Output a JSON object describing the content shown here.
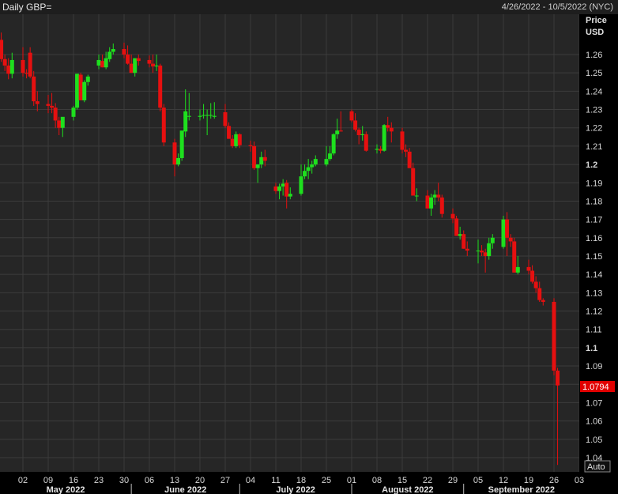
{
  "header": {
    "title": "Daily GBP=",
    "date_range": "4/26/2022 - 10/5/2022 (NYC)"
  },
  "axis": {
    "price_label": "Price",
    "currency_label": "USD",
    "auto_label": "Auto",
    "last_price_label": "1.0794"
  },
  "colors": {
    "background": "#262626",
    "grid": "#3c3c3c",
    "up": "#1ee01e",
    "down": "#e61010",
    "last_price_bg": "#e00000"
  },
  "chart_data": {
    "type": "candlestick",
    "title": "Daily GBP=",
    "ylabel": "Price USD",
    "ylim": [
      1.03,
      1.274
    ],
    "y_ticks": [
      1.04,
      1.05,
      1.06,
      1.07,
      1.08,
      1.09,
      1.1,
      1.11,
      1.12,
      1.13,
      1.14,
      1.15,
      1.16,
      1.17,
      1.18,
      1.19,
      1.2,
      1.21,
      1.22,
      1.23,
      1.24,
      1.25,
      1.26
    ],
    "y_tick_labels": [
      "1.04",
      "1.05",
      "1.06",
      "1.07",
      "",
      "1.09",
      "1.1",
      "1.11",
      "1.12",
      "1.13",
      "1.14",
      "1.15",
      "1.16",
      "1.17",
      "1.18",
      "1.19",
      "1.2",
      "1.21",
      "1.22",
      "1.23",
      "1.24",
      "1.25",
      "1.26"
    ],
    "bold_ticks": [
      "1.1",
      "1.2"
    ],
    "x_start": "2022-04-26",
    "x_end": "2022-10-05",
    "x_tick_dates": [
      "2022-05-02",
      "2022-05-09",
      "2022-05-16",
      "2022-05-23",
      "2022-05-30",
      "2022-06-06",
      "2022-06-13",
      "2022-06-20",
      "2022-06-27",
      "2022-07-04",
      "2022-07-11",
      "2022-07-18",
      "2022-07-25",
      "2022-08-01",
      "2022-08-08",
      "2022-08-15",
      "2022-08-22",
      "2022-08-29",
      "2022-09-05",
      "2022-09-12",
      "2022-09-19",
      "2022-09-26",
      "2022-10-03"
    ],
    "x_tick_labels": [
      "02",
      "09",
      "16",
      "23",
      "30",
      "06",
      "13",
      "20",
      "27",
      "04",
      "11",
      "18",
      "25",
      "01",
      "08",
      "15",
      "22",
      "29",
      "05",
      "12",
      "19",
      "26",
      "03"
    ],
    "months": [
      {
        "label": "May 2022",
        "date": "2022-05-02"
      },
      {
        "label": "June 2022",
        "date": "2022-06-01"
      },
      {
        "label": "July 2022",
        "date": "2022-07-01"
      },
      {
        "label": "August 2022",
        "date": "2022-08-01"
      },
      {
        "label": "September 2022",
        "date": "2022-09-01"
      }
    ],
    "last_price": 1.0794,
    "dates": [
      "2022-04-26",
      "2022-04-27",
      "2022-04-28",
      "2022-04-29",
      "2022-05-02",
      "2022-05-03",
      "2022-05-04",
      "2022-05-05",
      "2022-05-06",
      "2022-05-09",
      "2022-05-10",
      "2022-05-11",
      "2022-05-12",
      "2022-05-13",
      "2022-05-16",
      "2022-05-17",
      "2022-05-18",
      "2022-05-19",
      "2022-05-20",
      "2022-05-23",
      "2022-05-24",
      "2022-05-25",
      "2022-05-26",
      "2022-05-27",
      "2022-05-30",
      "2022-05-31",
      "2022-06-01",
      "2022-06-02",
      "2022-06-03",
      "2022-06-06",
      "2022-06-07",
      "2022-06-08",
      "2022-06-09",
      "2022-06-10",
      "2022-06-13",
      "2022-06-14",
      "2022-06-15",
      "2022-06-16",
      "2022-06-17",
      "2022-06-20",
      "2022-06-21",
      "2022-06-22",
      "2022-06-23",
      "2022-06-24",
      "2022-06-27",
      "2022-06-28",
      "2022-06-29",
      "2022-06-30",
      "2022-07-01",
      "2022-07-04",
      "2022-07-05",
      "2022-07-06",
      "2022-07-07",
      "2022-07-08",
      "2022-07-11",
      "2022-07-12",
      "2022-07-13",
      "2022-07-14",
      "2022-07-15",
      "2022-07-18",
      "2022-07-19",
      "2022-07-20",
      "2022-07-21",
      "2022-07-22",
      "2022-07-25",
      "2022-07-26",
      "2022-07-27",
      "2022-07-28",
      "2022-07-29",
      "2022-08-01",
      "2022-08-02",
      "2022-08-03",
      "2022-08-04",
      "2022-08-05",
      "2022-08-08",
      "2022-08-09",
      "2022-08-10",
      "2022-08-11",
      "2022-08-12",
      "2022-08-15",
      "2022-08-16",
      "2022-08-17",
      "2022-08-18",
      "2022-08-19",
      "2022-08-22",
      "2022-08-23",
      "2022-08-24",
      "2022-08-25",
      "2022-08-26",
      "2022-08-29",
      "2022-08-30",
      "2022-08-31",
      "2022-09-01",
      "2022-09-02",
      "2022-09-05",
      "2022-09-06",
      "2022-09-07",
      "2022-09-08",
      "2022-09-09",
      "2022-09-12",
      "2022-09-13",
      "2022-09-14",
      "2022-09-15",
      "2022-09-16",
      "2022-09-19",
      "2022-09-20",
      "2022-09-21",
      "2022-09-22",
      "2022-09-23",
      "2022-09-26",
      "2022-09-27"
    ],
    "open": [
      1.268,
      1.2575,
      1.254,
      1.2495,
      1.257,
      1.25,
      1.261,
      1.248,
      1.2345,
      1.233,
      1.232,
      1.231,
      1.224,
      1.22,
      1.226,
      1.231,
      1.249,
      1.235,
      1.245,
      1.254,
      1.2565,
      1.253,
      1.2575,
      1.2615,
      1.263,
      1.26,
      1.255,
      1.25,
      1.258,
      1.257,
      1.255,
      1.2535,
      1.254,
      1.231,
      1.212,
      1.2,
      1.2035,
      1.218,
      1.226,
      1.226,
      1.227,
      1.227,
      1.227,
      1.226,
      1.2285,
      1.221,
      1.214,
      1.21,
      1.2165,
      1.2105,
      1.21,
      1.198,
      1.2,
      1.204,
      1.188,
      1.1855,
      1.188,
      1.19,
      1.1825,
      1.184,
      1.1935,
      1.1965,
      1.1985,
      1.2,
      1.2,
      1.203,
      1.206,
      1.2165,
      1.2185,
      1.229,
      1.224,
      1.219,
      1.216,
      1.2165,
      1.208,
      1.2085,
      1.2075,
      1.2215,
      1.22,
      1.218,
      1.208,
      1.207,
      1.198,
      1.183,
      1.183,
      1.176,
      1.182,
      1.1835,
      1.182,
      1.173,
      1.1705,
      1.161,
      1.162,
      1.154,
      1.153,
      1.153,
      1.152,
      1.15,
      1.157,
      1.155,
      1.17,
      1.16,
      1.158,
      1.141,
      1.144,
      1.142,
      1.136,
      1.1325,
      1.126,
      1.125,
      1.0875
    ],
    "high": [
      1.272,
      1.26,
      1.258,
      1.261,
      1.264,
      1.252,
      1.264,
      1.251,
      1.24,
      1.238,
      1.239,
      1.2335,
      1.226,
      1.223,
      1.232,
      1.2495,
      1.25,
      1.246,
      1.249,
      1.26,
      1.26,
      1.2615,
      1.264,
      1.266,
      1.2665,
      1.265,
      1.26,
      1.258,
      1.26,
      1.2595,
      1.26,
      1.26,
      1.255,
      1.233,
      1.214,
      1.206,
      1.218,
      1.241,
      1.239,
      1.23,
      1.233,
      1.23,
      1.2335,
      1.234,
      1.233,
      1.223,
      1.216,
      1.218,
      1.217,
      1.213,
      1.2125,
      1.2,
      1.207,
      1.208,
      1.19,
      1.1895,
      1.192,
      1.1915,
      1.1875,
      1.2,
      1.2,
      1.203,
      1.202,
      1.205,
      1.21,
      1.21,
      1.217,
      1.225,
      1.229,
      1.23,
      1.228,
      1.22,
      1.221,
      1.218,
      1.211,
      1.21,
      1.222,
      1.226,
      1.223,
      1.22,
      1.211,
      1.209,
      1.201,
      1.187,
      1.186,
      1.184,
      1.186,
      1.19,
      1.1835,
      1.176,
      1.172,
      1.166,
      1.164,
      1.158,
      1.159,
      1.156,
      1.154,
      1.16,
      1.162,
      1.172,
      1.174,
      1.162,
      1.16,
      1.15,
      1.148,
      1.145,
      1.139,
      1.136,
      1.127,
      1.127,
      1.089
    ],
    "low": [
      1.256,
      1.251,
      1.2465,
      1.247,
      1.248,
      1.247,
      1.247,
      1.232,
      1.229,
      1.228,
      1.228,
      1.22,
      1.216,
      1.215,
      1.224,
      1.23,
      1.235,
      1.234,
      1.243,
      1.252,
      1.253,
      1.252,
      1.256,
      1.26,
      1.258,
      1.2545,
      1.25,
      1.248,
      1.254,
      1.253,
      1.25,
      1.251,
      1.229,
      1.21,
      1.1935,
      1.199,
      1.202,
      1.215,
      1.224,
      1.224,
      1.225,
      1.216,
      1.225,
      1.225,
      1.22,
      1.214,
      1.209,
      1.209,
      1.209,
      1.207,
      1.197,
      1.19,
      1.198,
      1.199,
      1.184,
      1.181,
      1.183,
      1.176,
      1.181,
      1.183,
      1.192,
      1.192,
      1.195,
      1.199,
      1.199,
      1.202,
      1.205,
      1.214,
      1.218,
      1.223,
      1.218,
      1.211,
      1.213,
      1.207,
      1.206,
      1.206,
      1.207,
      1.218,
      1.212,
      1.206,
      1.204,
      1.2,
      1.183,
      1.18,
      1.176,
      1.172,
      1.178,
      1.18,
      1.171,
      1.168,
      1.161,
      1.159,
      1.154,
      1.15,
      1.146,
      1.15,
      1.141,
      1.148,
      1.154,
      1.154,
      1.15,
      1.155,
      1.141,
      1.14,
      1.14,
      1.135,
      1.13,
      1.125,
      1.123,
      1.085,
      1.036
    ],
    "close": [
      1.2575,
      1.254,
      1.2495,
      1.257,
      1.25,
      1.2495,
      1.248,
      1.2345,
      1.233,
      1.232,
      1.231,
      1.224,
      1.22,
      1.226,
      1.231,
      1.2495,
      1.235,
      1.245,
      1.248,
      1.257,
      1.253,
      1.258,
      1.2615,
      1.263,
      1.26,
      1.255,
      1.25,
      1.258,
      1.2565,
      1.255,
      1.2535,
      1.254,
      1.231,
      1.212,
      1.2,
      1.2035,
      1.2185,
      1.229,
      1.2265,
      1.2265,
      1.227,
      1.227,
      1.227,
      1.2265,
      1.221,
      1.214,
      1.21,
      1.2165,
      1.2105,
      1.21,
      1.198,
      1.2,
      1.204,
      1.202,
      1.1855,
      1.188,
      1.1895,
      1.1825,
      1.184,
      1.1935,
      1.1965,
      1.1985,
      1.2,
      1.203,
      1.203,
      1.206,
      1.2165,
      1.2185,
      1.218,
      1.224,
      1.219,
      1.216,
      1.2165,
      1.2075,
      1.2085,
      1.2075,
      1.2215,
      1.22,
      1.218,
      1.208,
      1.207,
      1.198,
      1.183,
      1.183,
      1.176,
      1.182,
      1.1835,
      1.182,
      1.173,
      1.1705,
      1.161,
      1.162,
      1.154,
      1.153,
      1.153,
      1.152,
      1.15,
      1.157,
      1.16,
      1.17,
      1.16,
      1.158,
      1.141,
      1.144,
      1.142,
      1.136,
      1.1325,
      1.126,
      1.125,
      1.0875,
      1.0794
    ]
  }
}
